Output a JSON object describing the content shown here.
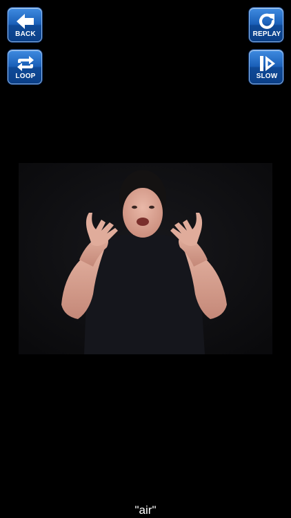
{
  "controls": {
    "back_label": "BACK",
    "loop_label": "LOOP",
    "replay_label": "REPLAY",
    "slow_label": "SLOW"
  },
  "icons": {
    "back": "arrow-left-icon",
    "loop": "loop-arrows-icon",
    "replay": "replay-arrow-icon",
    "slow": "slow-play-icon"
  },
  "colors": {
    "background": "#000000",
    "button_blue": "#1a5fb8",
    "caption_text": "#ffffff"
  },
  "caption": {
    "text": "\"air\""
  }
}
